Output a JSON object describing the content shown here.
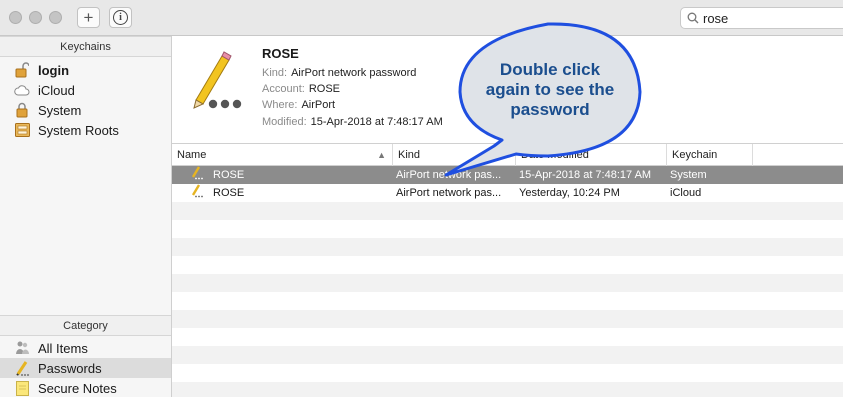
{
  "toolbar": {
    "add_label": "+",
    "info_label": "i",
    "search_value": "rose"
  },
  "sidebar": {
    "keychains_header": "Keychains",
    "keychains": [
      {
        "label": "login",
        "icon": "unlocked-padlock-icon"
      },
      {
        "label": "iCloud",
        "icon": "cloud-icon"
      },
      {
        "label": "System",
        "icon": "padlock-icon"
      },
      {
        "label": "System Roots",
        "icon": "cabinet-icon"
      }
    ],
    "category_header": "Category",
    "categories": [
      {
        "label": "All Items",
        "icon": "people-icon"
      },
      {
        "label": "Passwords",
        "icon": "pencil-icon"
      },
      {
        "label": "Secure Notes",
        "icon": "note-icon"
      }
    ]
  },
  "detail": {
    "title": "ROSE",
    "kind_label": "Kind:",
    "kind_value": "AirPort network password",
    "account_label": "Account:",
    "account_value": "ROSE",
    "where_label": "Where:",
    "where_value": "AirPort",
    "modified_label": "Modified:",
    "modified_value": "15-Apr-2018 at 7:48:17 AM"
  },
  "table": {
    "columns": [
      "Name",
      "Kind",
      "Date Modified",
      "Keychain"
    ],
    "rows": [
      {
        "name": "ROSE",
        "kind": "AirPort network pas...",
        "date": "15-Apr-2018 at 7:48:17 AM",
        "keychain": "System"
      },
      {
        "name": "ROSE",
        "kind": "AirPort network pas...",
        "date": "Yesterday, 10:24 PM",
        "keychain": "iCloud"
      }
    ]
  },
  "callout": {
    "line1": "Double click",
    "line2": "again to see the",
    "line3": "password"
  },
  "colors": {
    "selection": "#8c8c8c",
    "callout_fill": "#dfe3e8",
    "callout_border": "#1f4fe0",
    "callout_text": "#1b4e8e"
  }
}
